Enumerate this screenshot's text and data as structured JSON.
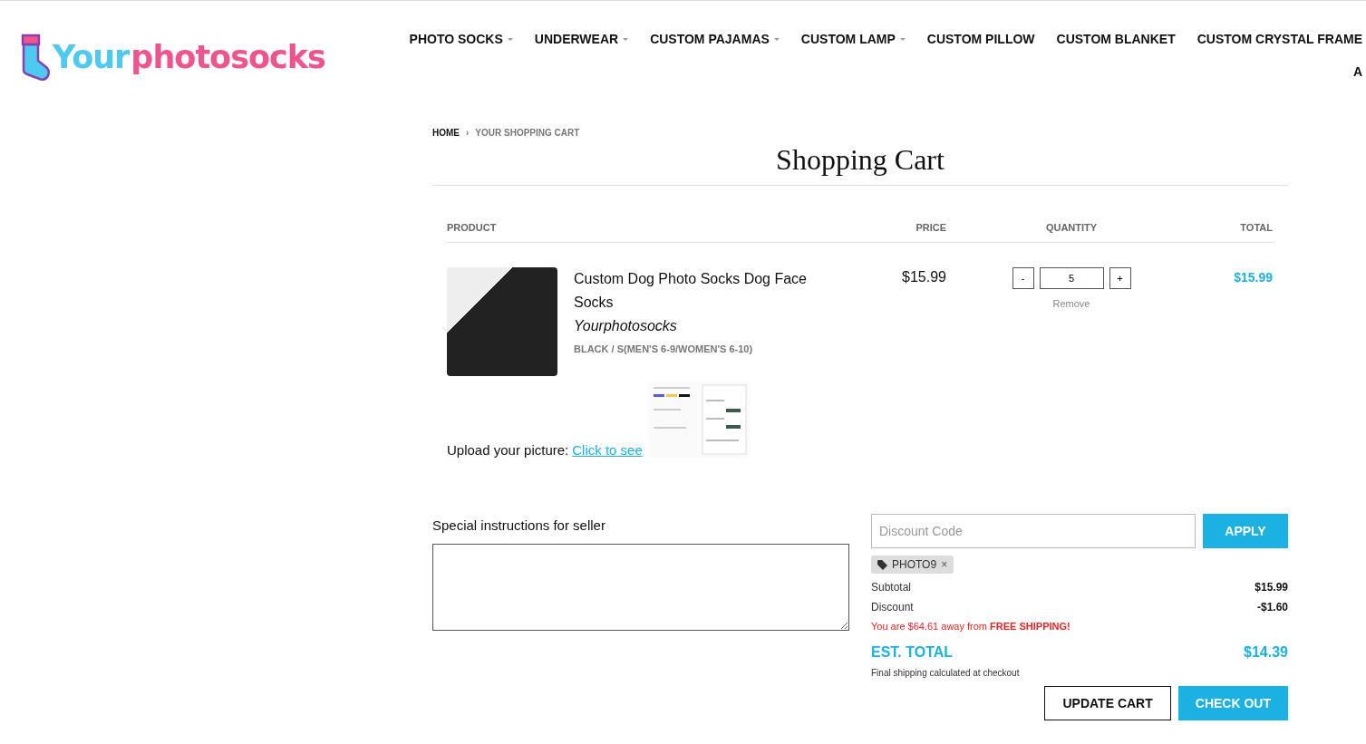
{
  "logo": {
    "parts": [
      {
        "text": "Your",
        "color": "#4ec9ef"
      },
      {
        "text": "photosocks",
        "color": "#f0548f"
      }
    ]
  },
  "nav": {
    "items": [
      {
        "label": "PHOTO SOCKS",
        "has_dropdown": true
      },
      {
        "label": "UNDERWEAR",
        "has_dropdown": true
      },
      {
        "label": "CUSTOM PAJAMAS",
        "has_dropdown": true
      },
      {
        "label": "CUSTOM LAMP",
        "has_dropdown": true
      },
      {
        "label": "CUSTOM PILLOW",
        "has_dropdown": false
      },
      {
        "label": "CUSTOM BLANKET",
        "has_dropdown": false
      },
      {
        "label": "CUSTOM CRYSTAL FRAME",
        "has_dropdown": false
      }
    ],
    "overflow_item": "A"
  },
  "breadcrumb": [
    {
      "label": "HOME",
      "current": false
    },
    {
      "label": "YOUR SHOPPING CART",
      "current": true
    }
  ],
  "breadcrumb_separator": "›",
  "title": "Shopping Cart",
  "table": {
    "columns": [
      "PRODUCT",
      "PRICE",
      "QUANTITY",
      "TOTAL"
    ],
    "rows": [
      {
        "name": "Custom Dog Photo Socks Dog Face Socks",
        "vendor": "Yourphotosocks",
        "variant": "BLACK / S(MEN'S 6-9/WOMEN'S 6-10)",
        "price": "$15.99",
        "decrease": "-",
        "quantity": "5",
        "increase": "+",
        "remove": "Remove",
        "total": "$15.99"
      }
    ]
  },
  "upload": {
    "label": "Upload your picture:",
    "link": "Click to see"
  },
  "instructions": {
    "label": "Special instructions for seller"
  },
  "discount": {
    "placeholder": "Discount Code",
    "apply": "APPLY",
    "codes": [
      {
        "code": "PHOTO9",
        "remove": "×"
      }
    ]
  },
  "summary": {
    "lines": [
      {
        "label": "Subtotal",
        "value": "$15.99"
      },
      {
        "label": "Discount",
        "value": "-$1.60"
      }
    ],
    "shipping_notice": "You are $64.61 away from **FREE SHIPPING!**",
    "total_label": "EST. TOTAL",
    "total_value": "$14.39",
    "note": "Final shipping calculated at checkout"
  },
  "buttons": [
    {
      "label": "UPDATE CART",
      "kind": "outline"
    },
    {
      "label": "CHECK OUT",
      "kind": "primary"
    }
  ]
}
